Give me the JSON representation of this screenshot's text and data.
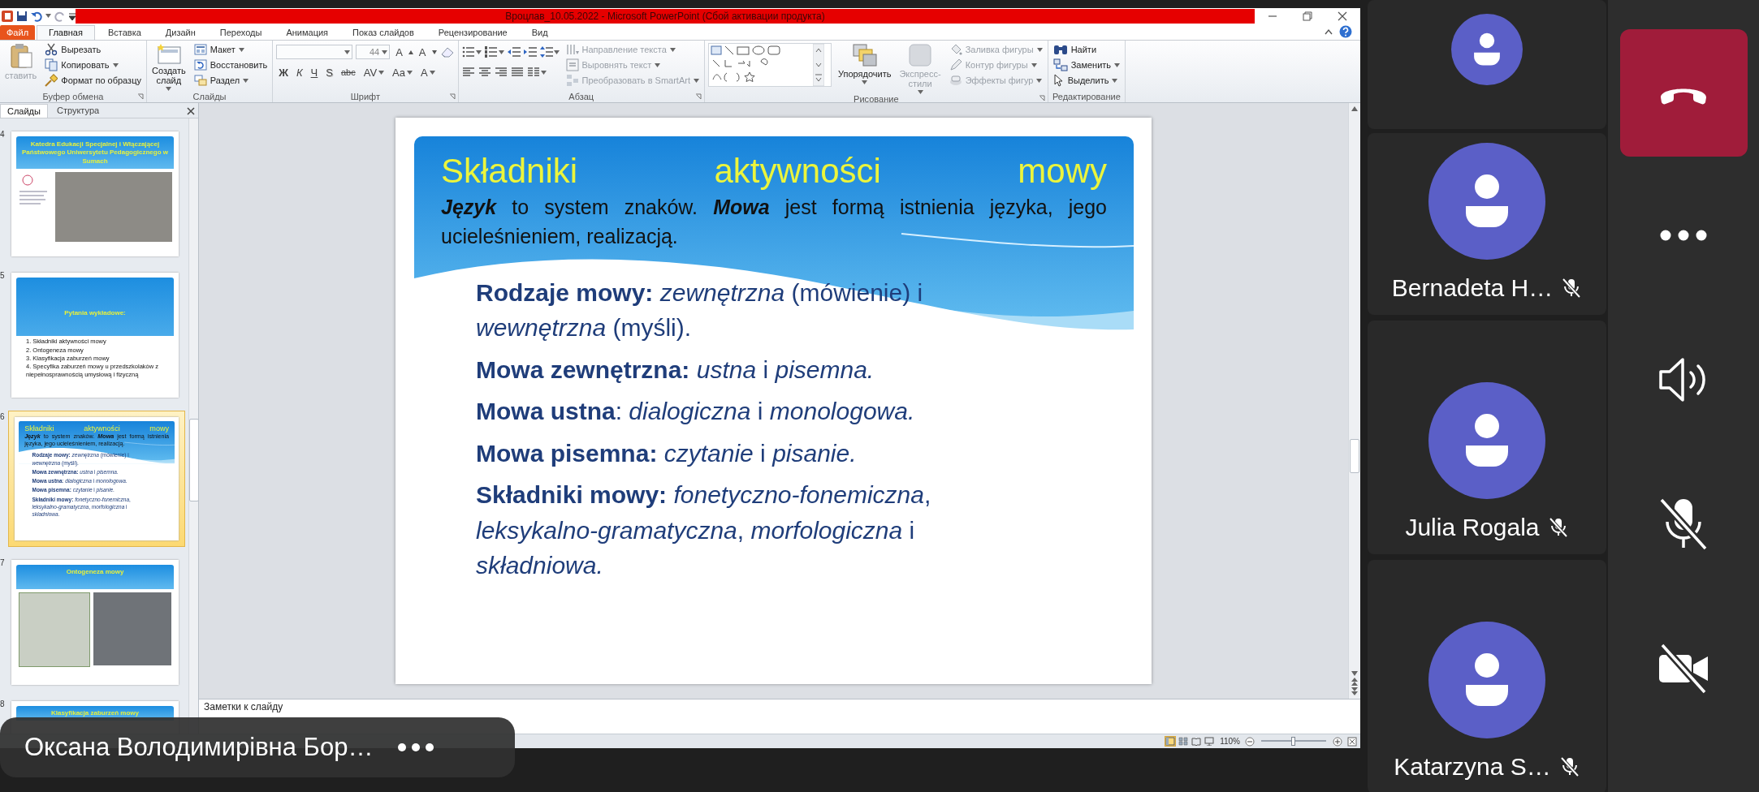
{
  "window": {
    "title": "Вроцлав_10.05.2022  -  Microsoft PowerPoint (Сбой активации продукта)"
  },
  "tabs": [
    {
      "label": "Файл",
      "kind": "file",
      "selected": false
    },
    {
      "label": "Главная",
      "kind": "tab",
      "selected": true
    },
    {
      "label": "Вставка",
      "kind": "tab",
      "selected": false
    },
    {
      "label": "Дизайн",
      "kind": "tab",
      "selected": false
    },
    {
      "label": "Переходы",
      "kind": "tab",
      "selected": false
    },
    {
      "label": "Анимация",
      "kind": "tab",
      "selected": false
    },
    {
      "label": "Показ слайдов",
      "kind": "tab",
      "selected": false
    },
    {
      "label": "Рецензирование",
      "kind": "tab",
      "selected": false
    },
    {
      "label": "Вид",
      "kind": "tab",
      "selected": false
    }
  ],
  "ribbon": [
    {
      "label": "Буфер обмена",
      "launcher": true,
      "columns": [
        [
          {
            "kind": "large",
            "label": "ставить",
            "disabled": true
          }
        ],
        [
          {
            "kind": "small",
            "label": "Вырезать",
            "disabled": false
          },
          {
            "kind": "small",
            "label": "Копировать",
            "dropdown": true,
            "disabled": false
          },
          {
            "kind": "small",
            "label": "Формат по образцу",
            "disabled": false
          }
        ]
      ]
    },
    {
      "label": "Слайды",
      "launcher": false,
      "columns": [
        [
          {
            "kind": "large",
            "label": "Создать слайд",
            "dropdown": true,
            "disabled": false
          }
        ],
        [
          {
            "kind": "small",
            "label": "Макет",
            "dropdown": true,
            "disabled": false
          },
          {
            "kind": "small",
            "label": "Восстановить",
            "disabled": false
          },
          {
            "kind": "small",
            "label": "Раздел",
            "dropdown": true,
            "disabled": false
          }
        ]
      ]
    },
    {
      "label": "Шрифт",
      "launcher": true,
      "columns": [
        [
          {
            "kind": "row",
            "items": [
              {
                "kind": "field",
                "dropdown": true
              },
              {
                "kind": "field",
                "value": "44",
                "dropdown": true
              },
              {
                "kind": "glyph",
                "label": "A"
              },
              {
                "kind": "icon"
              },
              {
                "kind": "glyph",
                "label": "A"
              },
              {
                "kind": "icon"
              },
              {
                "kind": "icon"
              }
            ]
          },
          {
            "kind": "row",
            "items": [
              {
                "kind": "glyph",
                "label": "Ж"
              },
              {
                "kind": "glyph",
                "label": "К"
              },
              {
                "kind": "glyph",
                "label": "Ч"
              },
              {
                "kind": "glyph",
                "label": "S"
              },
              {
                "kind": "glyph",
                "label": "abc"
              },
              {
                "kind": "glyph",
                "label": "AV",
                "dropdown": true
              },
              {
                "kind": "glyph",
                "label": "Aa",
                "dropdown": true
              },
              {
                "kind": "glyph",
                "label": "A",
                "dropdown": true
              }
            ]
          }
        ]
      ]
    },
    {
      "label": "Абзац",
      "launcher": true,
      "columns": [
        [
          {
            "kind": "row",
            "items": [
              {
                "kind": "icon",
                "dropdown": true
              },
              {
                "kind": "icon",
                "dropdown": true
              },
              {
                "kind": "icon"
              },
              {
                "kind": "icon"
              },
              {
                "kind": "icon",
                "dropdown": true
              }
            ]
          },
          {
            "kind": "row",
            "items": [
              {
                "kind": "icon"
              },
              {
                "kind": "icon"
              },
              {
                "kind": "icon"
              },
              {
                "kind": "icon"
              },
              {
                "kind": "icon",
                "dropdown": true
              }
            ]
          }
        ],
        [
          {
            "kind": "small",
            "label": "Направление текста",
            "dropdown": true,
            "disabled": true
          },
          {
            "kind": "small",
            "label": "Выровнять текст",
            "dropdown": true,
            "disabled": true
          },
          {
            "kind": "small",
            "label": "Преобразовать в SmartArt",
            "dropdown": true,
            "disabled": true
          }
        ]
      ]
    },
    {
      "label": "Рисование",
      "launcher": true,
      "columns": [
        [
          {
            "kind": "gallery"
          }
        ],
        [
          {
            "kind": "large",
            "label": "Упорядочить",
            "dropdown": true,
            "disabled": false
          }
        ],
        [
          {
            "kind": "large",
            "label": "Экспресс-стили",
            "dropdown": true,
            "disabled": true
          }
        ],
        [
          {
            "kind": "small",
            "label": "Заливка фигуры",
            "dropdown": true,
            "disabled": true
          },
          {
            "kind": "small",
            "label": "Контур фигуры",
            "dropdown": true,
            "disabled": true
          },
          {
            "kind": "small",
            "label": "Эффекты фигур",
            "dropdown": true,
            "disabled": true
          }
        ]
      ]
    },
    {
      "label": "Редактирование",
      "launcher": false,
      "columns": [
        [
          {
            "kind": "small",
            "label": "Найти",
            "disabled": false
          },
          {
            "kind": "small",
            "label": "Заменить",
            "dropdown": true,
            "disabled": false
          },
          {
            "kind": "small",
            "label": "Выделить",
            "dropdown": true,
            "disabled": false
          }
        ]
      ]
    }
  ],
  "panel_tabs": [
    {
      "label": "Слайды",
      "selected": true
    },
    {
      "label": "Структура",
      "selected": false
    }
  ],
  "thumbnails": [
    {
      "number": "4",
      "kind": "photo",
      "selected": false,
      "title": "Katedra Edukacji Specjalnej i Włączającej Państwowego Uniwersytetu Pedagogicznego w Sumach"
    },
    {
      "number": "5",
      "kind": "list",
      "selected": false,
      "title": "Pytania wykładowe:",
      "lines": [
        "1. Składniki aktywności mowy",
        "2. Ontogeneza mowy",
        "3. Klasyfikacja zaburzeń mowy",
        "4. Specyfika zaburzeń mowy u przedszkolaków z niepełnosprawnością umysłową i fizyczną"
      ]
    },
    {
      "number": "6",
      "kind": "content",
      "selected": true,
      "title": "Składniki aktywności mowy",
      "intro": "**Język** to system znaków. **Mowa** jest formą istnienia języka, jego ucieleśnieniem, realizacją.",
      "items": [
        "**Rodzaje mowy:** *zewnętrzna* (mówienie) i *wewnętrzna* (myśli).",
        "**Mowa zewnętrzna:** *ustna* i *pisemna.*",
        "**Mowa ustna**: *dialogiczna* i *monologowa.*",
        "**Mowa pisemna:** *czytanie* i *pisanie.*",
        "**Składniki mowy:** *fonetyczno-fonemiczna*, *leksykalno-gramatyczna*, *morfologiczna* i *składniowa.*"
      ]
    },
    {
      "number": "7",
      "kind": "tables",
      "selected": false,
      "title": "Ontogeneza mowy"
    },
    {
      "number": "8",
      "kind": "title",
      "selected": false,
      "title": "Klasyfikacja zaburzeń mowy"
    }
  ],
  "slide": {
    "title": "Składniki aktywności mowy",
    "intro": "**Język** to system znaków. **Mowa** jest formą istnienia języka, jego ucieleśnieniem, realizacją.",
    "items": [
      "**Rodzaje mowy:** *zewnętrzna* (mówienie) i *wewnętrzna* (myśli).",
      "**Mowa zewnętrzna:** *ustna* i *pisemna.*",
      "**Mowa ustna**: *dialogiczna* i *monologowa.*",
      "**Mowa pisemna:** *czytanie* i *pisanie.*",
      "**Składniki mowy:** *fonetyczno-fonemiczna*, *leksykalno-gramatyczna*, *morfologiczna* i *składniowa.*"
    ]
  },
  "notes": {
    "placeholder": "Заметки к слайду"
  },
  "status_bar": {
    "views": [
      {
        "selected": true
      },
      {
        "selected": false
      },
      {
        "selected": false
      },
      {
        "selected": false
      }
    ],
    "zoom": "110%",
    "zoom_slider": {
      "level": 0.5
    }
  },
  "participants": [
    {
      "muted": false
    },
    {
      "name": "Bernadeta H…",
      "muted": true
    },
    {
      "name": "Julia Rogala",
      "muted": true
    },
    {
      "name": "Katarzyna S…",
      "muted": true
    }
  ],
  "call_controls": [
    {
      "kind": "hangup"
    },
    {
      "kind": "more"
    },
    {
      "kind": "speaker"
    },
    {
      "kind": "mic",
      "on": false
    },
    {
      "kind": "camera",
      "on": false
    }
  ],
  "presenter": {
    "name": "Оксана Володимирівна Бор…"
  }
}
